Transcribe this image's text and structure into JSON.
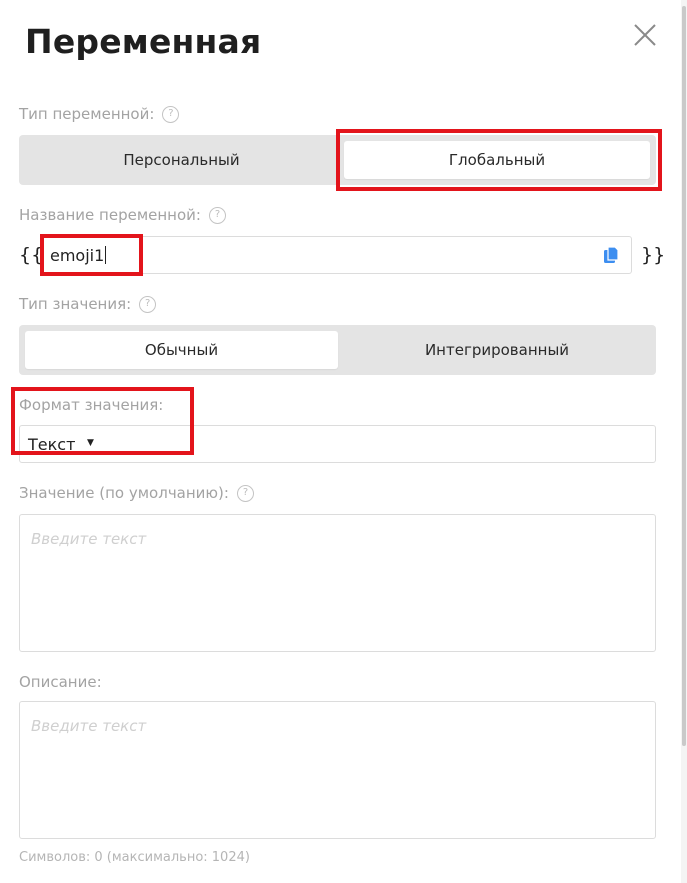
{
  "dialog": {
    "title": "Переменная"
  },
  "variable_type": {
    "label": "Тип переменной:",
    "options": [
      "Персональный",
      "Глобальный"
    ],
    "selected": "Глобальный"
  },
  "variable_name": {
    "label": "Название переменной:",
    "brace_open": "{{",
    "brace_close": "}}",
    "value": "emoji1"
  },
  "value_type": {
    "label": "Тип значения:",
    "options": [
      "Обычный",
      "Интегрированный"
    ],
    "selected": "Обычный"
  },
  "value_format": {
    "label": "Формат значения:",
    "selected": "Текст"
  },
  "default_value": {
    "label": "Значение (по умолчанию):",
    "placeholder": "Введите текст"
  },
  "description": {
    "label": "Описание:",
    "placeholder": "Введите текст",
    "counter": "Символов: 0 (максимально: 1024)"
  },
  "colors": {
    "highlight": "#e3141b",
    "accent_icon": "#3d8ef0",
    "segment_bg": "#e4e4e4"
  }
}
